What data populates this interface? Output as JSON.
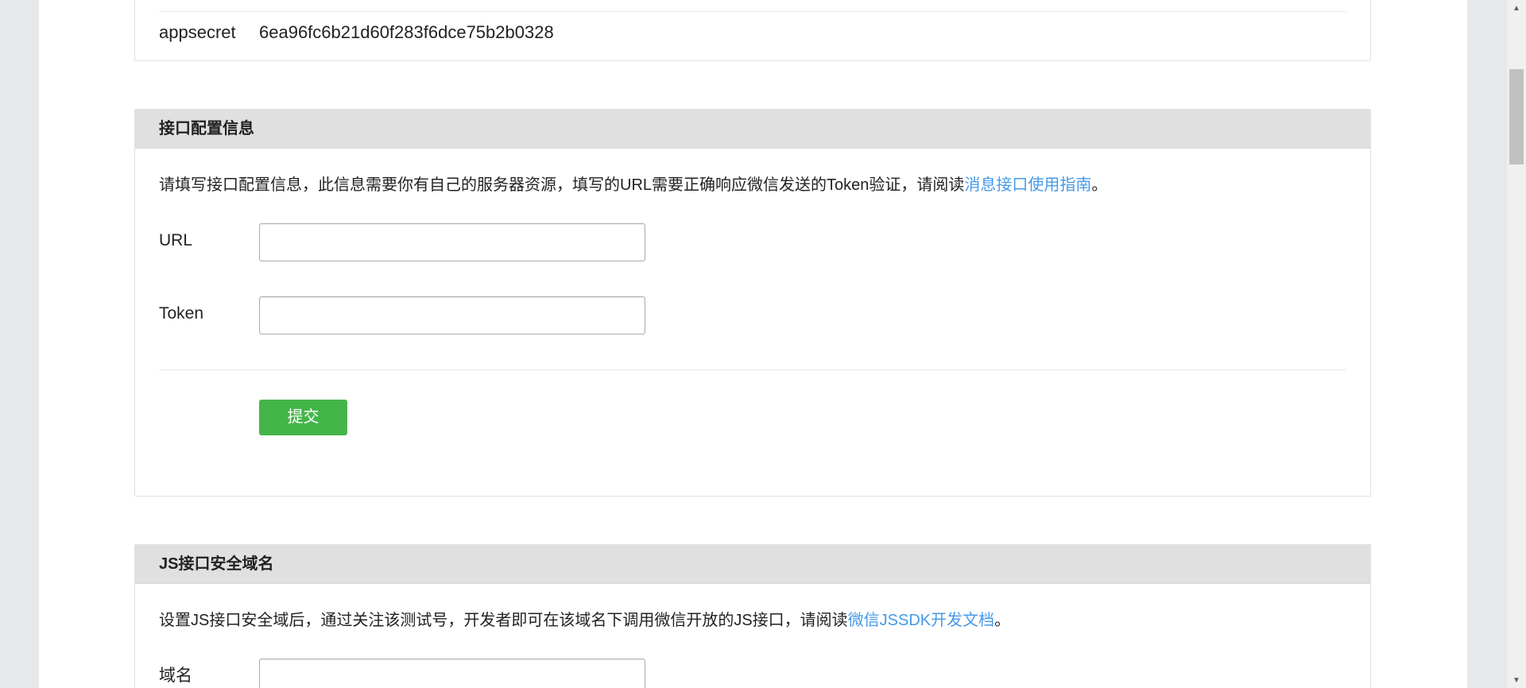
{
  "app_section": {
    "label": "appsecret",
    "value": "6ea96fc6b21d60f283f6dce75b2b0328"
  },
  "interface_config": {
    "title": "接口配置信息",
    "description_prefix": "请填写接口配置信息，此信息需要你有自己的服务器资源，填写的URL需要正确响应微信发送的Token验证，请阅读",
    "description_link": "消息接口使用指南",
    "description_suffix": "。",
    "url_label": "URL",
    "url_value": "",
    "token_label": "Token",
    "token_value": "",
    "submit_label": "提交"
  },
  "js_domain": {
    "title": "JS接口安全域名",
    "description_prefix": "设置JS接口安全域后，通过关注该测试号，开发者即可在该域名下调用微信开放的JS接口，请阅读",
    "description_link": "微信JSSDK开发文档",
    "description_suffix": "。",
    "domain_label": "域名",
    "domain_value": ""
  },
  "colors": {
    "link": "#459ae9",
    "submit_button": "#44b549",
    "panel_header": "#e0e0e0",
    "background": "#e7e8eb"
  },
  "scrollbar": {
    "up_icon": "scroll-up-arrow",
    "down_icon": "scroll-down-arrow"
  }
}
